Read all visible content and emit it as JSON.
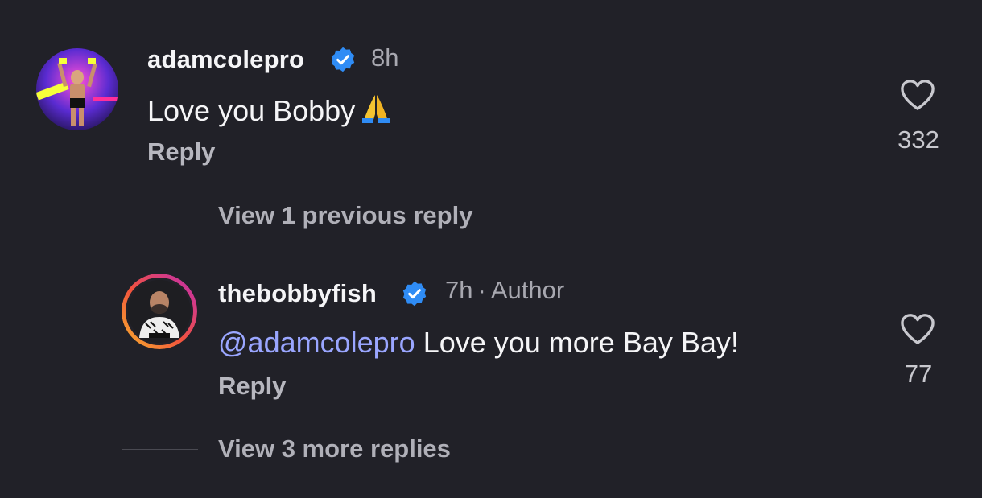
{
  "comments": [
    {
      "username": "adamcolepro",
      "verified": true,
      "time": "8h",
      "text": "Love you Bobby",
      "emoji": "folded-hands",
      "reply_label": "Reply",
      "likes": "332"
    }
  ],
  "thread": {
    "view_previous_label": "View 1 previous reply",
    "reply": {
      "username": "thebobbyfish",
      "verified": true,
      "time": "7h",
      "separator": "·",
      "badge": "Author",
      "mention": "@adamcolepro",
      "text": "Love you more Bay Bay!",
      "reply_label": "Reply",
      "likes": "77"
    },
    "view_more_label": "View 3 more replies"
  },
  "colors": {
    "background": "#212128",
    "verified_blue": "#2f8cf5",
    "mention": "#9aa6ff"
  },
  "icons": [
    "verified-badge-icon",
    "heart-icon",
    "threads-at-icon"
  ]
}
